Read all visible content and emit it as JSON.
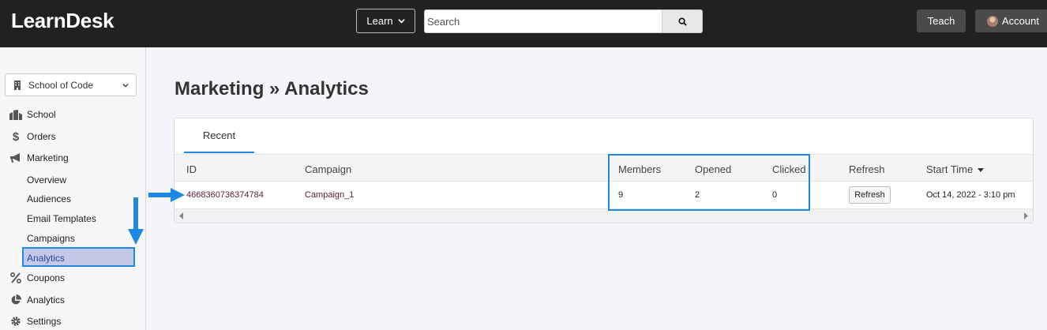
{
  "header": {
    "logo": "LearnDesk",
    "learn_label": "Learn",
    "search_placeholder": "Search",
    "teach_label": "Teach",
    "account_label": "Account"
  },
  "sidebar": {
    "school_select": "School of Code",
    "items": [
      {
        "label": "School",
        "icon": "building-icon"
      },
      {
        "label": "Orders",
        "icon": "dollar-icon"
      },
      {
        "label": "Marketing",
        "icon": "megaphone-icon"
      }
    ],
    "marketing_sub": [
      "Overview",
      "Audiences",
      "Email Templates",
      "Campaigns",
      "Analytics"
    ],
    "items_after": [
      {
        "label": "Coupons",
        "icon": "percent-icon"
      },
      {
        "label": "Analytics",
        "icon": "pie-chart-icon"
      },
      {
        "label": "Settings",
        "icon": "gear-icon"
      }
    ]
  },
  "main": {
    "title": "Marketing » Analytics",
    "tabs": [
      "Recent"
    ],
    "table": {
      "headers": [
        "ID",
        "Campaign",
        "Members",
        "Opened",
        "Clicked",
        "Refresh",
        "Start Time"
      ],
      "rows": [
        {
          "id": "4668360736374784",
          "campaign": "Campaign_1",
          "members": "9",
          "opened": "2",
          "clicked": "0",
          "refresh_label": "Refresh",
          "start_time": "Oct 14, 2022 - 3:10 pm"
        }
      ]
    }
  },
  "colors": {
    "topbar": "#212121",
    "accent": "#1e88e5",
    "active_bg": "#c3c8e6"
  }
}
